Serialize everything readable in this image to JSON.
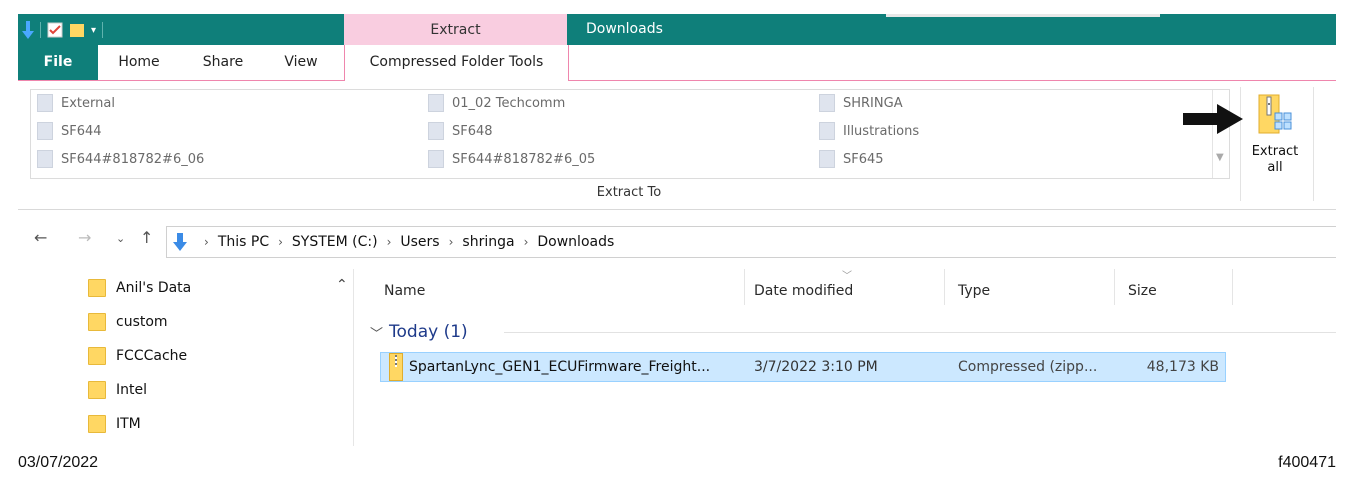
{
  "title_bar": {
    "context_tab": "Extract",
    "window_title": "Downloads"
  },
  "ribbon": {
    "tabs": [
      "File",
      "Home",
      "Share",
      "View",
      "Compressed Folder Tools"
    ],
    "gallery_items": [
      [
        "External",
        "SF644",
        "SF644#818782#6_06"
      ],
      [
        "01_02 Techcomm",
        "SF648",
        "SF644#818782#6_05"
      ],
      [
        "SHRINGA",
        "Illustrations",
        "SF645"
      ]
    ],
    "group_label": "Extract To",
    "extract_all_line1": "Extract",
    "extract_all_line2": "all"
  },
  "address": {
    "breadcrumbs": [
      "This PC",
      "SYSTEM (C:)",
      "Users",
      "shringa",
      "Downloads"
    ]
  },
  "nav_pane": {
    "items": [
      "Anil's Data",
      "custom",
      "FCCCache",
      "Intel",
      "ITM"
    ]
  },
  "file_list": {
    "columns": [
      "Name",
      "Date modified",
      "Type",
      "Size"
    ],
    "group_header": "Today (1)",
    "rows": [
      {
        "name": "SpartanLync_GEN1_ECUFirmware_Freight...",
        "date": "3/7/2022 3:10 PM",
        "type": "Compressed (zipp...",
        "size": "48,173 KB"
      }
    ]
  },
  "captions": {
    "date": "03/07/2022",
    "figure_id": "f400471"
  },
  "colors": {
    "title_bar": "#0f7f7a",
    "context_tab": "#f9cde0",
    "selection": "#cce8ff",
    "folder": "#ffd763"
  }
}
